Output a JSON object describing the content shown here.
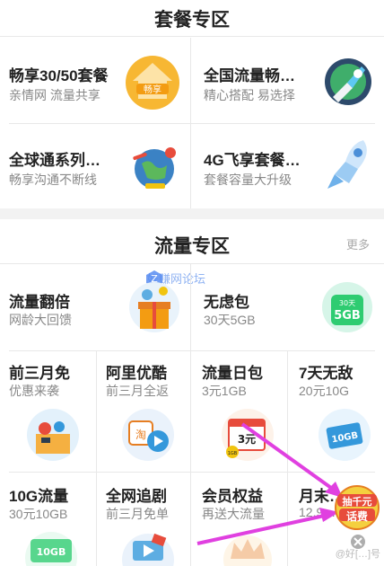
{
  "package_zone": {
    "title": "套餐专区",
    "items": [
      {
        "title": "畅享30/50套餐",
        "subtitle": "亲情网 流量共享",
        "icon": "house-icon",
        "icon_text": "畅享"
      },
      {
        "title": "全国流量畅…",
        "subtitle": "精心搭配 易选择",
        "icon": "rocket-globe-icon"
      },
      {
        "title": "全球通系列…",
        "subtitle": "畅享沟通不断线",
        "icon": "globe-plane-icon"
      },
      {
        "title": "4G飞享套餐…",
        "subtitle": "套餐容量大升级",
        "icon": "rocket-icon"
      }
    ]
  },
  "data_zone": {
    "title": "流量专区",
    "more_label": "更多",
    "featured": [
      {
        "title": "流量翻倍",
        "subtitle": "网龄大回馈",
        "icon": "gift-box-icon"
      },
      {
        "title": "无虑包",
        "subtitle": "30天5GB",
        "icon": "data-pack-icon",
        "icon_top": "30天",
        "icon_main": "5GB"
      }
    ],
    "grid_row1": [
      {
        "title": "前三月免",
        "subtitle": "优惠来袭",
        "icon": "discount-box-icon"
      },
      {
        "title": "阿里优酷",
        "subtitle": "前三月全返",
        "icon": "taobao-youku-icon",
        "icon_text": "淘"
      },
      {
        "title": "流量日包",
        "subtitle": "3元1GB",
        "icon": "calendar-icon",
        "icon_text": "3元",
        "icon_foot": "1GB"
      },
      {
        "title": "7天无敌",
        "subtitle": "20元10G",
        "icon": "ticket-icon",
        "icon_text": "10GB"
      }
    ],
    "grid_row2": [
      {
        "title": "10G流量",
        "subtitle": "30元10GB",
        "icon": "data-10gb-icon",
        "icon_text": "10GB"
      },
      {
        "title": "全网追剧",
        "subtitle": "前三月免单",
        "icon": "video-icon"
      },
      {
        "title": "会员权益",
        "subtitle": "再送大流量",
        "icon": "crown-icon"
      },
      {
        "title": "月末…",
        "subtitle": "12.9…",
        "icon": "monthend-icon"
      }
    ]
  },
  "overlay": {
    "watermark": "好赚网论坛",
    "promo_line1": "抽千元",
    "promo_line2": "话费",
    "bottom_watermark": "@好[…]号"
  },
  "colors": {
    "accent_orange": "#f5a623",
    "promo_magenta": "#e040e0",
    "watermark_blue": "#4f86f0"
  }
}
